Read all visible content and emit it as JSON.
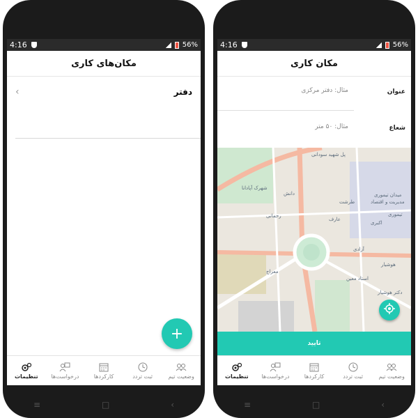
{
  "status_bar": {
    "time": "4:16",
    "battery": "56%"
  },
  "left_screen": {
    "title": "مکان‌های کاری",
    "list": [
      {
        "label": "دفتر"
      }
    ],
    "fab_label": "+"
  },
  "right_screen": {
    "title": "مکان کاری",
    "fields": [
      {
        "label": "عنوان",
        "placeholder": "مثال: دفتر مرکزی"
      },
      {
        "label": "شعاع",
        "placeholder": "مثال: ۵۰ متر"
      }
    ],
    "map_labels": [
      "پل شهید سودانی",
      "شهرک آپادانا",
      "دانش",
      "میدان تیموری",
      "مدیریت و اقتصاد",
      "طرشت",
      "رحمانی",
      "عارف",
      "آزادی",
      "اکبری",
      "استاد معین",
      "معراج",
      "هوشیار",
      "دکتر هوشیار",
      "تیموری"
    ],
    "confirm_label": "تایید"
  },
  "bottom_nav": [
    {
      "label": "وضعیت تیم",
      "icon": "team-status-icon"
    },
    {
      "label": "ثبت تردد",
      "icon": "clock-icon"
    },
    {
      "label": "کارکردها",
      "icon": "calendar-icon"
    },
    {
      "label": "درخواست‌ها",
      "icon": "requests-icon"
    },
    {
      "label": "تنظیمات",
      "icon": "settings-icon",
      "active": true
    }
  ],
  "colors": {
    "accent": "#22c9b3",
    "status_bar": "#2b2b2b",
    "phone_body": "#1b1b1b"
  }
}
